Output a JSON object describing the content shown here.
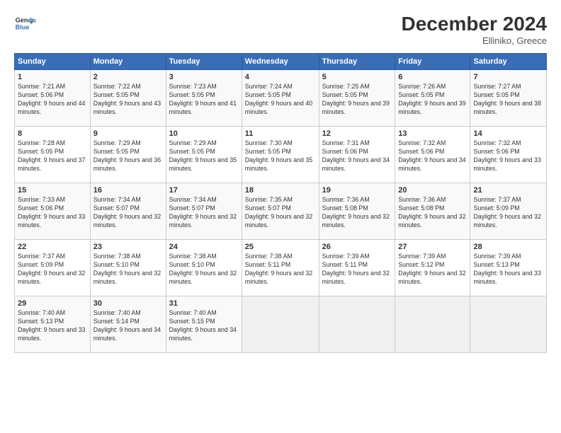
{
  "header": {
    "logo_line1": "General",
    "logo_line2": "Blue",
    "month": "December 2024",
    "location": "Elliniko, Greece"
  },
  "weekdays": [
    "Sunday",
    "Monday",
    "Tuesday",
    "Wednesday",
    "Thursday",
    "Friday",
    "Saturday"
  ],
  "weeks": [
    [
      {
        "day": "1",
        "sunrise": "Sunrise: 7:21 AM",
        "sunset": "Sunset: 5:06 PM",
        "daylight": "Daylight: 9 hours and 44 minutes."
      },
      {
        "day": "2",
        "sunrise": "Sunrise: 7:22 AM",
        "sunset": "Sunset: 5:05 PM",
        "daylight": "Daylight: 9 hours and 43 minutes."
      },
      {
        "day": "3",
        "sunrise": "Sunrise: 7:23 AM",
        "sunset": "Sunset: 5:05 PM",
        "daylight": "Daylight: 9 hours and 41 minutes."
      },
      {
        "day": "4",
        "sunrise": "Sunrise: 7:24 AM",
        "sunset": "Sunset: 5:05 PM",
        "daylight": "Daylight: 9 hours and 40 minutes."
      },
      {
        "day": "5",
        "sunrise": "Sunrise: 7:25 AM",
        "sunset": "Sunset: 5:05 PM",
        "daylight": "Daylight: 9 hours and 39 minutes."
      },
      {
        "day": "6",
        "sunrise": "Sunrise: 7:26 AM",
        "sunset": "Sunset: 5:05 PM",
        "daylight": "Daylight: 9 hours and 39 minutes."
      },
      {
        "day": "7",
        "sunrise": "Sunrise: 7:27 AM",
        "sunset": "Sunset: 5:05 PM",
        "daylight": "Daylight: 9 hours and 38 minutes."
      }
    ],
    [
      {
        "day": "8",
        "sunrise": "Sunrise: 7:28 AM",
        "sunset": "Sunset: 5:05 PM",
        "daylight": "Daylight: 9 hours and 37 minutes."
      },
      {
        "day": "9",
        "sunrise": "Sunrise: 7:29 AM",
        "sunset": "Sunset: 5:05 PM",
        "daylight": "Daylight: 9 hours and 36 minutes."
      },
      {
        "day": "10",
        "sunrise": "Sunrise: 7:29 AM",
        "sunset": "Sunset: 5:05 PM",
        "daylight": "Daylight: 9 hours and 35 minutes."
      },
      {
        "day": "11",
        "sunrise": "Sunrise: 7:30 AM",
        "sunset": "Sunset: 5:05 PM",
        "daylight": "Daylight: 9 hours and 35 minutes."
      },
      {
        "day": "12",
        "sunrise": "Sunrise: 7:31 AM",
        "sunset": "Sunset: 5:06 PM",
        "daylight": "Daylight: 9 hours and 34 minutes."
      },
      {
        "day": "13",
        "sunrise": "Sunrise: 7:32 AM",
        "sunset": "Sunset: 5:06 PM",
        "daylight": "Daylight: 9 hours and 34 minutes."
      },
      {
        "day": "14",
        "sunrise": "Sunrise: 7:32 AM",
        "sunset": "Sunset: 5:06 PM",
        "daylight": "Daylight: 9 hours and 33 minutes."
      }
    ],
    [
      {
        "day": "15",
        "sunrise": "Sunrise: 7:33 AM",
        "sunset": "Sunset: 5:06 PM",
        "daylight": "Daylight: 9 hours and 33 minutes."
      },
      {
        "day": "16",
        "sunrise": "Sunrise: 7:34 AM",
        "sunset": "Sunset: 5:07 PM",
        "daylight": "Daylight: 9 hours and 32 minutes."
      },
      {
        "day": "17",
        "sunrise": "Sunrise: 7:34 AM",
        "sunset": "Sunset: 5:07 PM",
        "daylight": "Daylight: 9 hours and 32 minutes."
      },
      {
        "day": "18",
        "sunrise": "Sunrise: 7:35 AM",
        "sunset": "Sunset: 5:07 PM",
        "daylight": "Daylight: 9 hours and 32 minutes."
      },
      {
        "day": "19",
        "sunrise": "Sunrise: 7:36 AM",
        "sunset": "Sunset: 5:08 PM",
        "daylight": "Daylight: 9 hours and 32 minutes."
      },
      {
        "day": "20",
        "sunrise": "Sunrise: 7:36 AM",
        "sunset": "Sunset: 5:08 PM",
        "daylight": "Daylight: 9 hours and 32 minutes."
      },
      {
        "day": "21",
        "sunrise": "Sunrise: 7:37 AM",
        "sunset": "Sunset: 5:09 PM",
        "daylight": "Daylight: 9 hours and 32 minutes."
      }
    ],
    [
      {
        "day": "22",
        "sunrise": "Sunrise: 7:37 AM",
        "sunset": "Sunset: 5:09 PM",
        "daylight": "Daylight: 9 hours and 32 minutes."
      },
      {
        "day": "23",
        "sunrise": "Sunrise: 7:38 AM",
        "sunset": "Sunset: 5:10 PM",
        "daylight": "Daylight: 9 hours and 32 minutes."
      },
      {
        "day": "24",
        "sunrise": "Sunrise: 7:38 AM",
        "sunset": "Sunset: 5:10 PM",
        "daylight": "Daylight: 9 hours and 32 minutes."
      },
      {
        "day": "25",
        "sunrise": "Sunrise: 7:38 AM",
        "sunset": "Sunset: 5:11 PM",
        "daylight": "Daylight: 9 hours and 32 minutes."
      },
      {
        "day": "26",
        "sunrise": "Sunrise: 7:39 AM",
        "sunset": "Sunset: 5:11 PM",
        "daylight": "Daylight: 9 hours and 32 minutes."
      },
      {
        "day": "27",
        "sunrise": "Sunrise: 7:39 AM",
        "sunset": "Sunset: 5:12 PM",
        "daylight": "Daylight: 9 hours and 32 minutes."
      },
      {
        "day": "28",
        "sunrise": "Sunrise: 7:39 AM",
        "sunset": "Sunset: 5:13 PM",
        "daylight": "Daylight: 9 hours and 33 minutes."
      }
    ],
    [
      {
        "day": "29",
        "sunrise": "Sunrise: 7:40 AM",
        "sunset": "Sunset: 5:13 PM",
        "daylight": "Daylight: 9 hours and 33 minutes."
      },
      {
        "day": "30",
        "sunrise": "Sunrise: 7:40 AM",
        "sunset": "Sunset: 5:14 PM",
        "daylight": "Daylight: 9 hours and 34 minutes."
      },
      {
        "day": "31",
        "sunrise": "Sunrise: 7:40 AM",
        "sunset": "Sunset: 5:15 PM",
        "daylight": "Daylight: 9 hours and 34 minutes."
      },
      null,
      null,
      null,
      null
    ]
  ]
}
